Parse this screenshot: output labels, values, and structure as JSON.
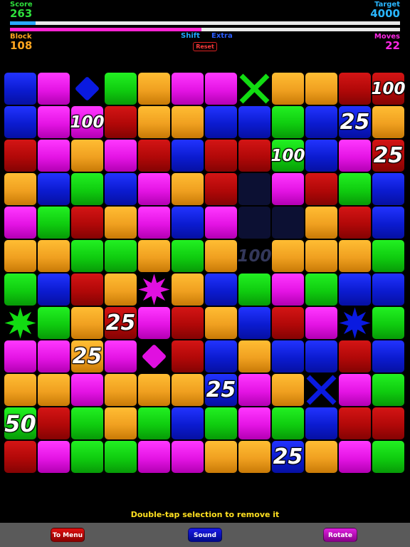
{
  "hud": {
    "score_label": "Score",
    "score_value": "263",
    "target_label": "Target",
    "target_value": "4000",
    "block_label": "Block",
    "block_value": "108",
    "moves_label": "Moves",
    "moves_value": "22",
    "shift_label": "Shift",
    "extra_label": "Extra",
    "reset_label": "Reset",
    "score_progress": 0.066,
    "moves_progress": 0.49,
    "colors": {
      "score": "#2ee03c",
      "target": "#29b6ff",
      "block": "#ffa51f",
      "moves": "#ff28e6",
      "shift": "#1ea7ff",
      "extra": "#2b5dff",
      "score_bar": "#2aa7ff",
      "moves_bar": "#ff23d2"
    }
  },
  "board": {
    "rows": [
      [
        "blue",
        "magenta",
        "blue-diamond",
        "green",
        "orange",
        "magenta",
        "magenta",
        "green-x",
        "orange",
        "orange",
        "red",
        "red:100"
      ],
      [
        "blue",
        "magenta",
        "magenta:100",
        "red",
        "orange",
        "orange",
        "blue",
        "blue",
        "green",
        "blue",
        "blue:25",
        "orange"
      ],
      [
        "red",
        "magenta",
        "orange",
        "magenta",
        "red",
        "blue",
        "red",
        "red",
        "green:100",
        "blue",
        "magenta",
        "red:25"
      ],
      [
        "orange",
        "blue",
        "green",
        "blue",
        "magenta",
        "orange",
        "red",
        "empty",
        "magenta",
        "red",
        "green",
        "blue"
      ],
      [
        "magenta",
        "green",
        "red",
        "orange",
        "magenta",
        "blue",
        "magenta",
        "empty",
        "empty",
        "orange",
        "red",
        "blue"
      ],
      [
        "orange",
        "orange",
        "green",
        "green",
        "orange",
        "green",
        "orange",
        "ghost:100",
        "orange",
        "orange",
        "orange",
        "green"
      ],
      [
        "green",
        "blue",
        "red",
        "orange",
        "magenta-star",
        "orange",
        "blue",
        "green",
        "magenta",
        "green",
        "blue",
        "blue"
      ],
      [
        "green-star",
        "green",
        "orange",
        "red:25",
        "magenta",
        "red",
        "orange",
        "blue",
        "red",
        "magenta",
        "blue-star",
        "green"
      ],
      [
        "magenta",
        "magenta",
        "orange:25",
        "magenta",
        "magenta-diamond",
        "red",
        "blue",
        "orange",
        "blue",
        "blue",
        "red",
        "blue"
      ],
      [
        "orange",
        "orange",
        "magenta",
        "orange",
        "orange",
        "orange",
        "blue:25",
        "magenta",
        "orange",
        "blue-x",
        "magenta",
        "green"
      ],
      [
        "green:50",
        "red",
        "green",
        "orange",
        "green",
        "blue",
        "green",
        "magenta",
        "green",
        "blue",
        "red",
        "red"
      ],
      [
        "red",
        "magenta",
        "green",
        "green",
        "magenta",
        "magenta",
        "orange",
        "orange",
        "blue:25",
        "orange",
        "magenta",
        "green"
      ]
    ]
  },
  "hint": "Double-tap selection to remove it",
  "toolbar": {
    "menu_label": "To Menu",
    "sound_label": "Sound",
    "rotate_label": "Rotate",
    "menu_color": "#e01010",
    "sound_color": "#1a1ae8",
    "rotate_color": "#e01fe0"
  }
}
